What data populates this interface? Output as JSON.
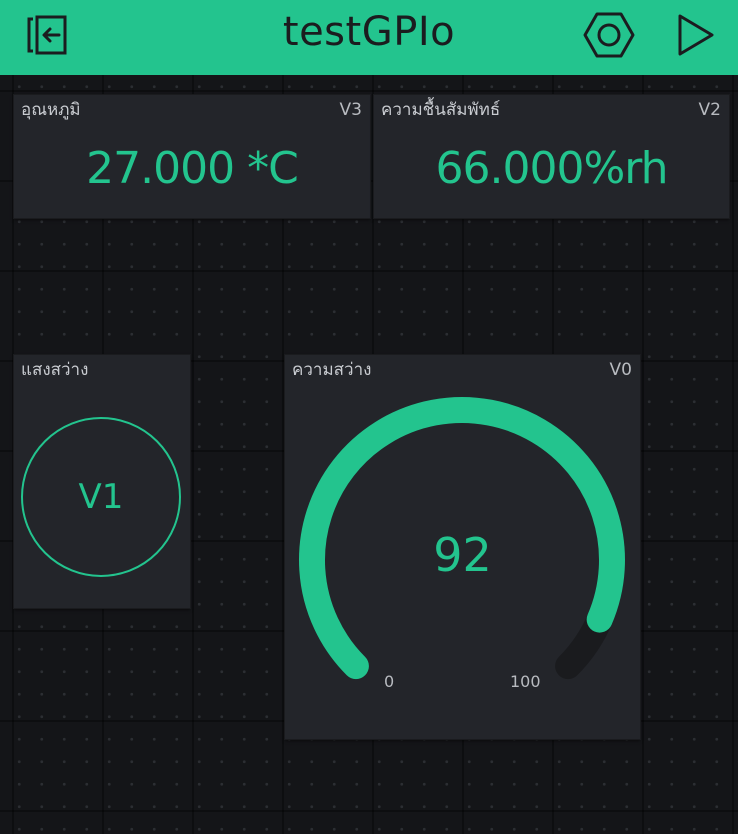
{
  "header": {
    "title": "testGPIo",
    "bg_color": "#23c48e",
    "back_icon": "exit-project-icon",
    "settings_icon": "hexagon-settings-icon",
    "play_icon": "play-icon"
  },
  "widgets": {
    "temperature": {
      "label": "อุณหภูมิ",
      "pin": "V3",
      "value": "27.000 *C"
    },
    "humidity": {
      "label": "ความชื้นสัมพัทธ์",
      "pin": "V2",
      "value": "66.000%rh"
    },
    "light_led": {
      "label": "แสงสว่าง",
      "value": "V1"
    },
    "light_gauge": {
      "label": "ความสว่าง",
      "pin": "V0",
      "value": "92",
      "level": 92,
      "min": "0",
      "max": "100",
      "accent": "#23c48e"
    }
  }
}
